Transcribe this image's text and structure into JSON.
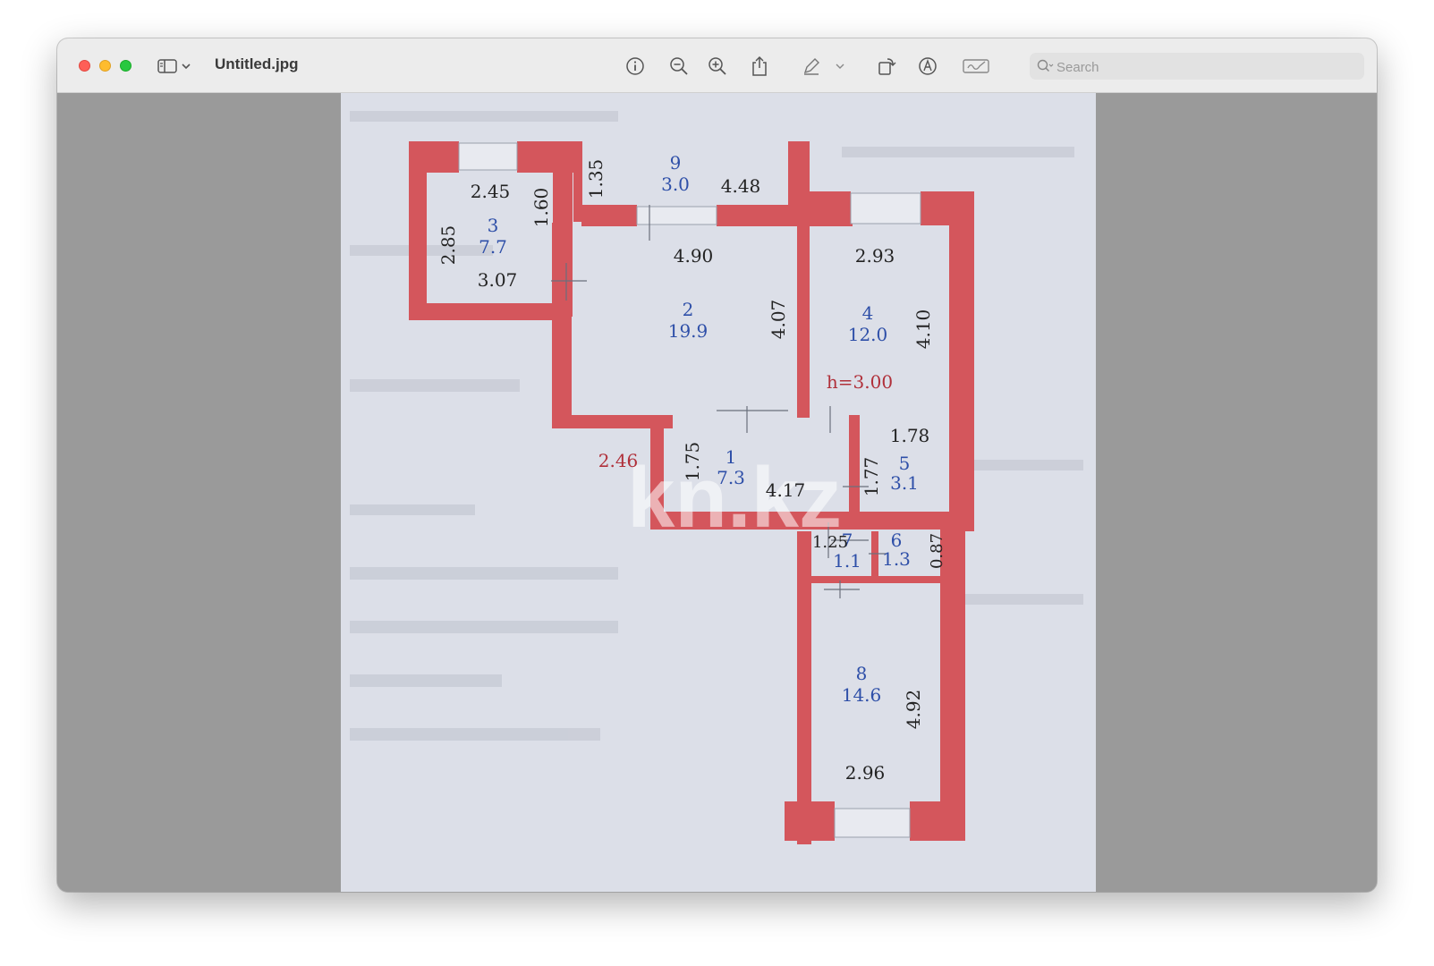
{
  "window": {
    "title": "Untitled.jpg"
  },
  "toolbar": {
    "icons": [
      "sidebar-icon",
      "chevron-down-icon",
      "info-icon",
      "zoom-out-icon",
      "zoom-in-icon",
      "share-icon",
      "markup-pen-icon",
      "chevron-down-icon",
      "rotate-icon",
      "annotate-icon",
      "signature-icon"
    ],
    "search_placeholder": "Search"
  },
  "floor_plan": {
    "colors": {
      "wall": "#d4565c",
      "paper": "#dcdfe8",
      "room_number": "#2e4fa8",
      "dimension": "#222222",
      "height_note": "#b0303a"
    },
    "watermark": "kn.kz",
    "height_note": "h=3.00",
    "outer_dimension": "2.46",
    "rooms": [
      {
        "number": "9",
        "area": "3.0",
        "dims": [
          "1.35",
          "4.48"
        ]
      },
      {
        "number": "3",
        "area": "7.7",
        "dims": [
          "2.45",
          "1.60",
          "2.85",
          "3.07"
        ]
      },
      {
        "number": "2",
        "area": "19.9",
        "dims": [
          "4.90",
          "4.07"
        ]
      },
      {
        "number": "4",
        "area": "12.0",
        "dims": [
          "2.93",
          "4.10"
        ]
      },
      {
        "number": "1",
        "area": "7.3",
        "dims": [
          "1.75",
          "4.17"
        ]
      },
      {
        "number": "5",
        "area": "3.1",
        "dims": [
          "1.78",
          "1.77"
        ]
      },
      {
        "number": "7",
        "area": "1.1",
        "dims": [
          "1.25"
        ]
      },
      {
        "number": "6",
        "area": "1.3",
        "dims": [
          "0.87"
        ]
      },
      {
        "number": "8",
        "area": "14.6",
        "dims": [
          "4.92",
          "2.96"
        ]
      }
    ]
  }
}
